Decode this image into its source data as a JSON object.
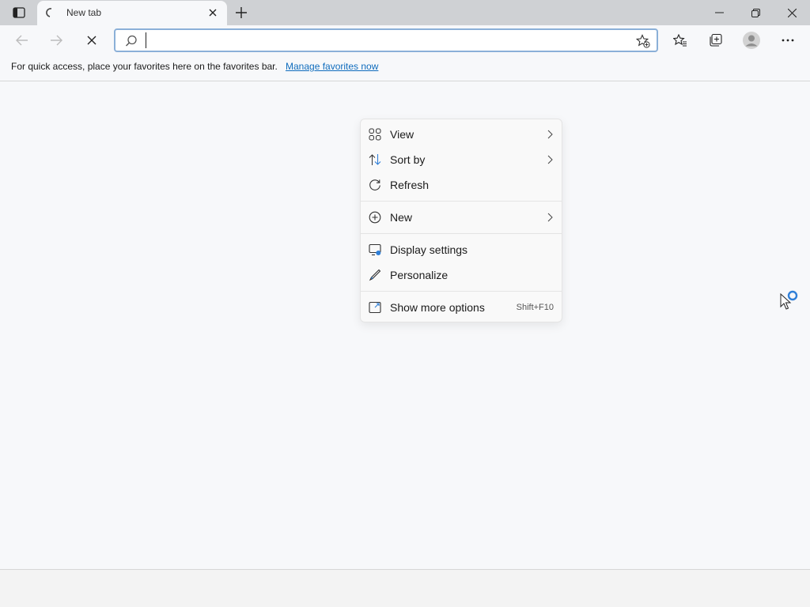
{
  "browser": {
    "tab": {
      "title": "New tab"
    },
    "favorites_bar": {
      "text": "For quick access, place your favorites here on the favorites bar.",
      "link": "Manage favorites now"
    },
    "address": {
      "value": "",
      "placeholder": ""
    }
  },
  "context_menu": {
    "items": [
      {
        "label": "View",
        "icon": "view-grid-icon",
        "submenu": true
      },
      {
        "label": "Sort by",
        "icon": "sort-icon",
        "submenu": true
      },
      {
        "label": "Refresh",
        "icon": "refresh-icon",
        "submenu": false
      },
      {
        "label": "New",
        "icon": "new-plus-icon",
        "submenu": true
      },
      {
        "label": "Display settings",
        "icon": "display-icon",
        "submenu": false
      },
      {
        "label": "Personalize",
        "icon": "pen-icon",
        "submenu": false
      },
      {
        "label": "Show more options",
        "icon": "more-options-icon",
        "submenu": false,
        "shortcut": "Shift+F10"
      }
    ]
  },
  "colors": {
    "link": "#0f6cbd",
    "accent_blue": "#2f7fd8",
    "address_border": "#8bb0d8"
  }
}
